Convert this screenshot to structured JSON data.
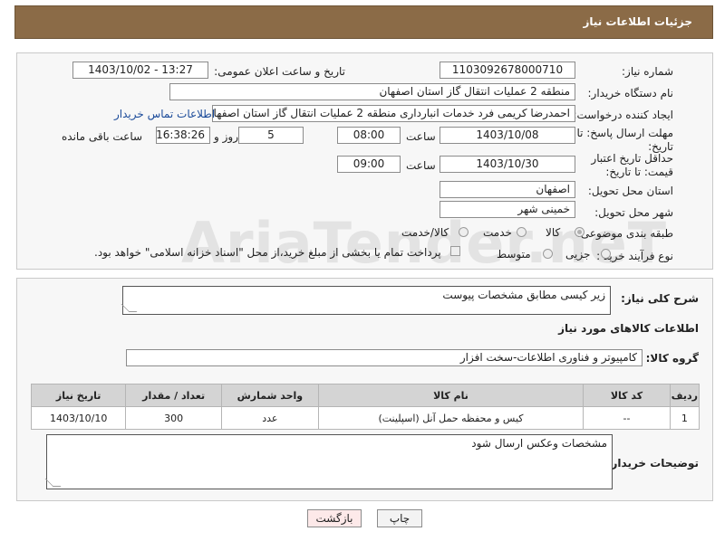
{
  "header": {
    "title": "جزئیات اطلاعات نیاز"
  },
  "form": {
    "need_number_label": "شماره نیاز:",
    "need_number": "1103092678000710",
    "announce_label": "تاریخ و ساعت اعلان عمومی:",
    "announce_value": "1403/10/02 - 13:27",
    "buyer_org_label": "نام دستگاه خریدار:",
    "buyer_org": "منطقه 2 عملیات انتقال گاز استان اصفهان",
    "requester_label": "ایجاد کننده درخواست:",
    "requester": "احمدرضا کریمی فرد خدمات انبارداری منطقه 2 عملیات انتقال گاز استان اصفهان",
    "contact_link": "اطلاعات تماس خریدار",
    "reply_deadline_label": "مهلت ارسال پاسخ: تا تاریخ:",
    "reply_date": "1403/10/08",
    "time_label": "ساعت",
    "reply_time": "08:00",
    "days": "5",
    "day_and_label": "روز و",
    "remaining_time": "16:38:26",
    "remaining_label": "ساعت باقی مانده",
    "price_validity_label": "حداقل تاریخ اعتبار قیمت: تا تاریخ:",
    "validity_date": "1403/10/30",
    "validity_time": "09:00",
    "province_label": "استان محل تحویل:",
    "province": "اصفهان",
    "city_label": "شهر محل تحویل:",
    "city": "خمینی شهر",
    "category_label": "طبقه بندی موضوعی:",
    "category_options": [
      "کالا",
      "خدمت",
      "کالا/خدمت"
    ],
    "process_label": "نوع فرآیند خرید :",
    "process_options": [
      "جزیی",
      "متوسط"
    ],
    "payment_note": "پرداخت تمام یا بخشی از مبلغ خرید،از محل \"اسناد خزانه اسلامی\" خواهد بود."
  },
  "details": {
    "description_label": "شرح کلی نیاز:",
    "description": "زیر کیسی مطابق مشخصات پیوست",
    "goods_info_title": "اطلاعات کالاهای مورد نیاز",
    "goods_group_label": "گروه کالا:",
    "goods_group": "کامپیوتر و فناوری اطلاعات-سخت افزار",
    "table": {
      "headers": [
        "ردیف",
        "کد کالا",
        "نام کالا",
        "واحد شمارش",
        "تعداد / مقدار",
        "تاریخ نیاز"
      ],
      "rows": [
        [
          "1",
          "--",
          "کیس و محفظه حمل آنل (اسپلینت)",
          "عدد",
          "300",
          "1403/10/10"
        ]
      ]
    },
    "buyer_notes_label": "توضیحات خریدار:",
    "buyer_notes": "مشخصات وعکس ارسال شود"
  },
  "buttons": {
    "print": "چاپ",
    "back": "بازگشت"
  },
  "watermark": "AriaTender.neT",
  "colors": {
    "header": "#8b6b47",
    "link": "#1a4a99",
    "back_button": "#fde9e9"
  }
}
